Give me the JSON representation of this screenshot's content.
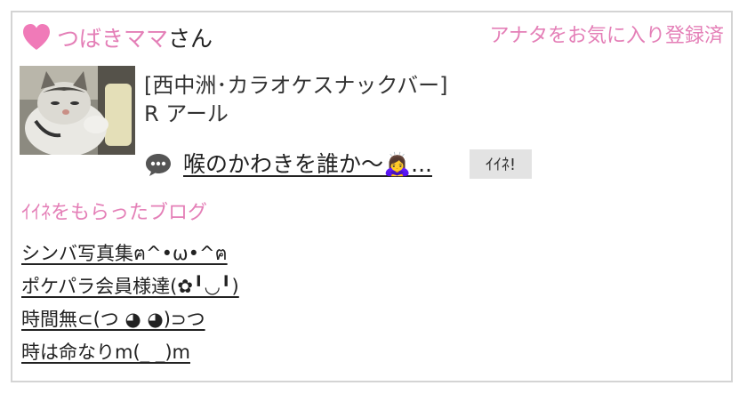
{
  "header": {
    "heart_icon": "heart-icon",
    "user_name": "つばきママ",
    "user_suffix": "さん",
    "favorite_status": "アナタをお気に入り登録済"
  },
  "profile": {
    "avatar": "cat-photo",
    "shop_area": "[西中洲･カラオケスナックバー]",
    "shop_name": "R アール"
  },
  "post": {
    "icon": "speech-bubble-icon",
    "text": "喉のかわきを誰か〜🙇‍♀️...",
    "like_label": "ｲｲﾈ!"
  },
  "liked_blogs": {
    "heading": "ｲｲﾈをもらったブログ",
    "items": [
      "シンバ写真集ฅ^•ω•^ฅ",
      "ポケパラ会員様達(✿╹◡╹)",
      "時間無⊂(つ ◕ ◕)⊃つ",
      "時は命なりm(_ _)m"
    ]
  },
  "colors": {
    "accent": "#e47fb7",
    "border": "#d4d4d4",
    "button_bg": "#e3e3e3"
  }
}
